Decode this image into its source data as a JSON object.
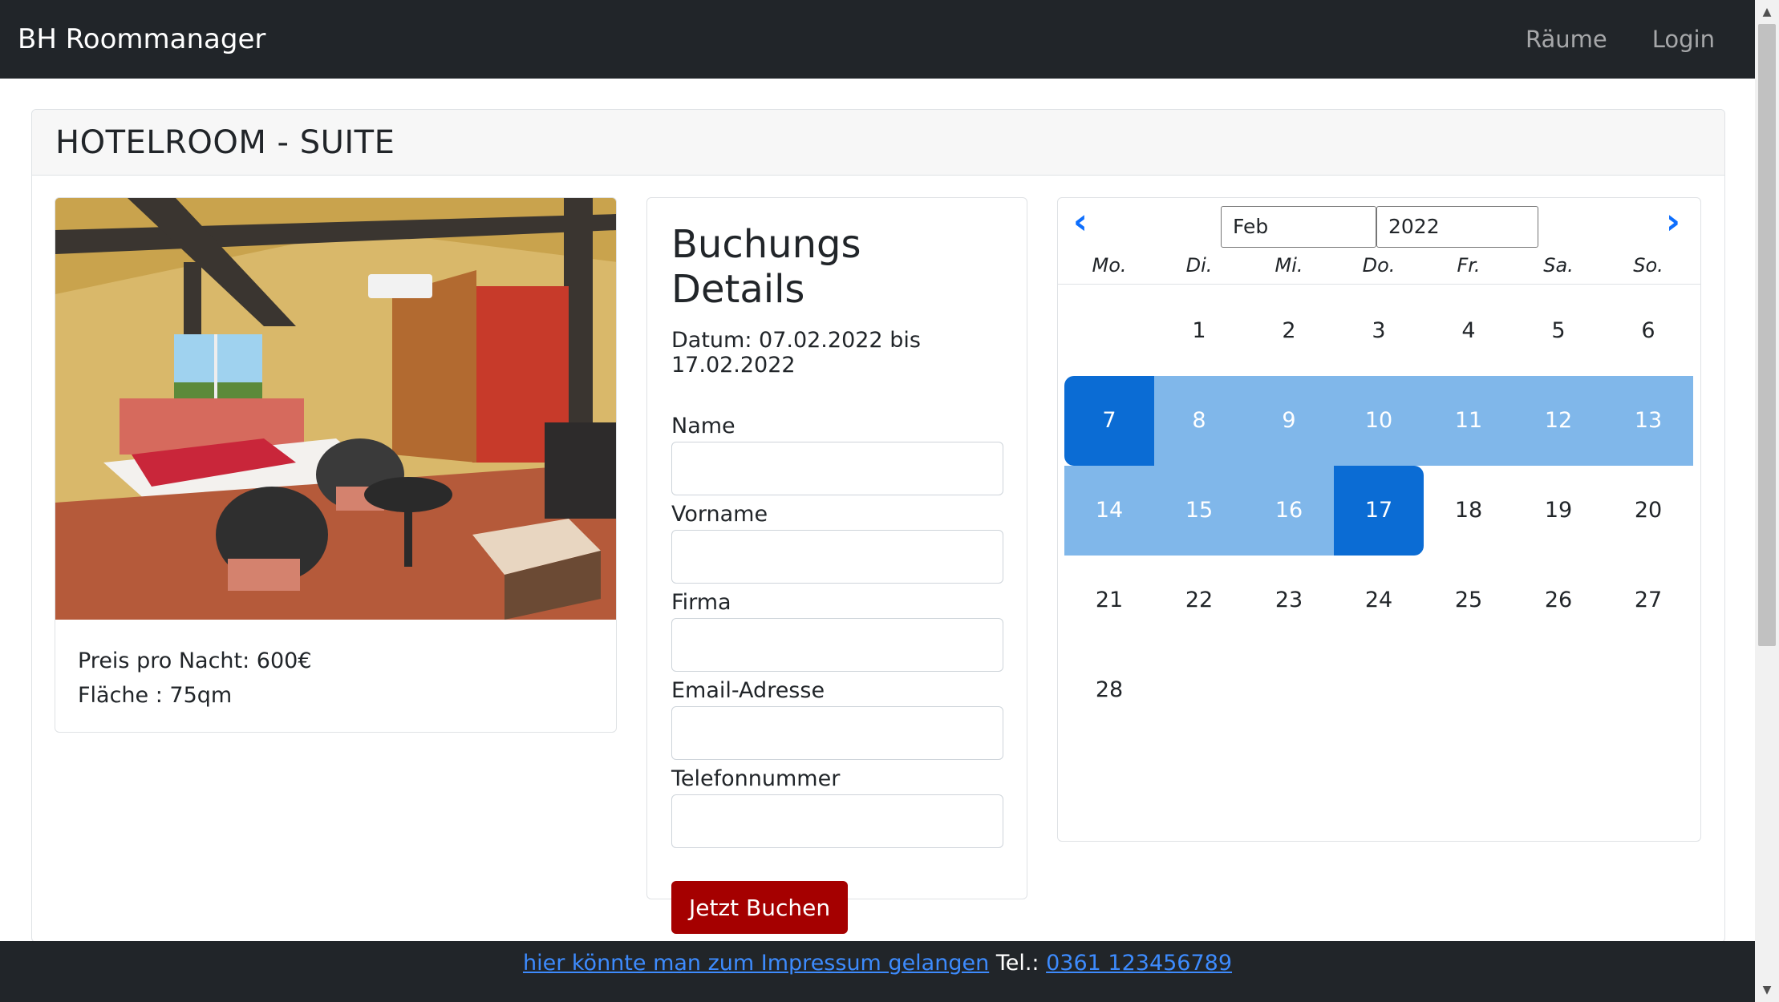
{
  "navbar": {
    "brand": "BH Roommanager",
    "links": [
      "Räume",
      "Login"
    ]
  },
  "room": {
    "title": "HOTELROOM - SUITE",
    "image_alt": "hotel room photo",
    "price": "Preis pro Nacht: 600€",
    "area": "Fläche : 75qm"
  },
  "booking": {
    "title": "Buchungs Details",
    "date_range": "Datum: 07.02.2022 bis 17.02.2022",
    "fields": [
      {
        "label": "Name",
        "value": ""
      },
      {
        "label": "Vorname",
        "value": ""
      },
      {
        "label": "Firma",
        "value": ""
      },
      {
        "label": "Email-Adresse",
        "value": ""
      },
      {
        "label": "Telefonnummer",
        "value": ""
      }
    ],
    "submit_label": "Jetzt Buchen"
  },
  "calendar": {
    "month": "Feb",
    "year": "2022",
    "prev_icon": "chevron-left-icon",
    "next_icon": "chevron-right-icon",
    "weekdays": [
      "Mo.",
      "Di.",
      "Mi.",
      "Do.",
      "Fr.",
      "Sa.",
      "So."
    ],
    "first_weekday_offset": 1,
    "days_in_month": 28,
    "range_start": 7,
    "range_end": 17
  },
  "footer": {
    "impressum_link": "hier könnte man zum Impressum gelangen",
    "tel_label": "Tel.:",
    "tel_number": "0361 123456789"
  },
  "colors": {
    "navbar_bg": "#212529",
    "range_bg": "#80b7ea",
    "selected_bg": "#0b6cd4",
    "button_bg": "#a50000",
    "link": "#0d6efd"
  }
}
